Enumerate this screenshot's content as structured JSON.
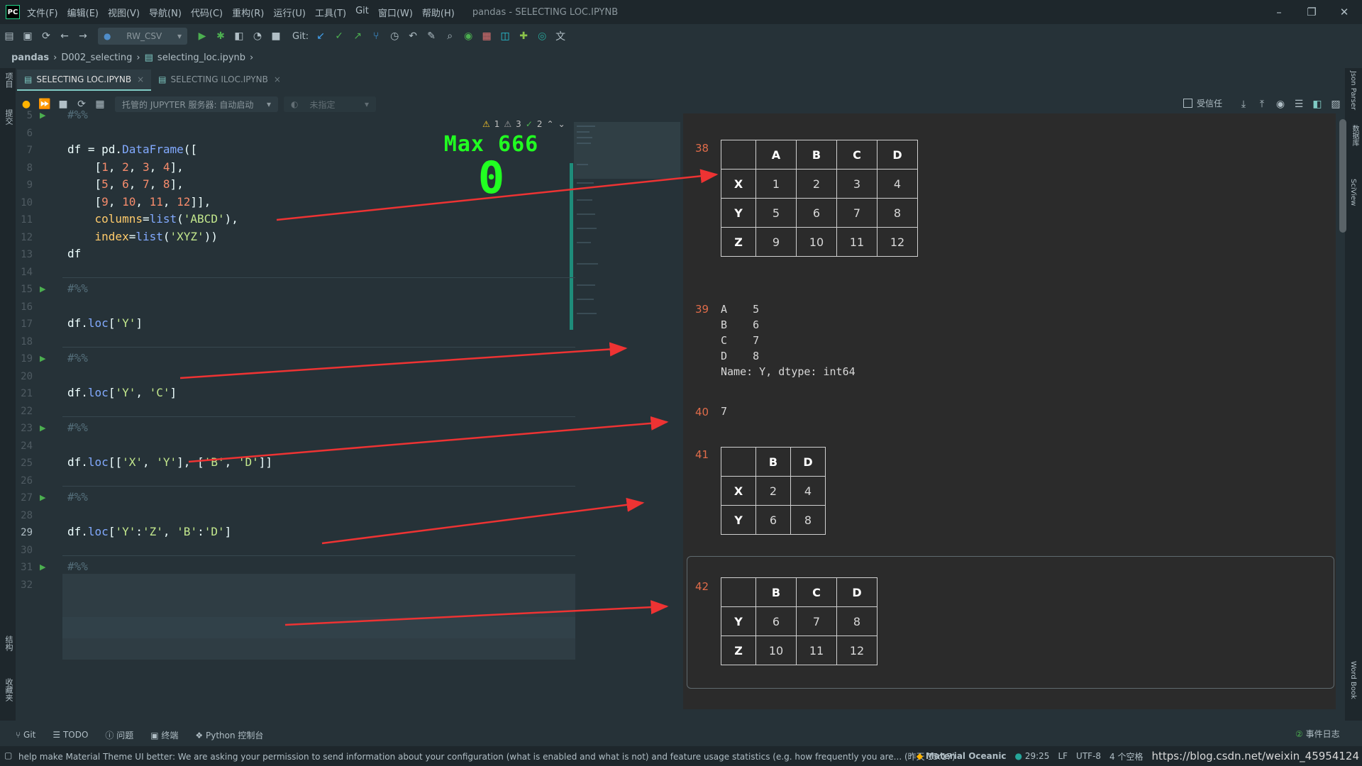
{
  "window": {
    "menus": [
      "文件(F)",
      "编辑(E)",
      "视图(V)",
      "导航(N)",
      "代码(C)",
      "重构(R)",
      "运行(U)",
      "工具(T)",
      "Git",
      "窗口(W)",
      "帮助(H)"
    ],
    "title": "pandas - SELECTING LOC.IPYNB"
  },
  "toolbar": {
    "run_config": "RW_CSV",
    "git_label": "Git:"
  },
  "breadcrumb": [
    "pandas",
    "D002_selecting",
    "selecting_loc.ipynb"
  ],
  "tabs": [
    {
      "label": "SELECTING LOC.IPYNB",
      "active": true
    },
    {
      "label": "SELECTING ILOC.IPYNB",
      "active": false
    }
  ],
  "notebook_bar": {
    "server": "托管的 JUPYTER 服务器: 自动启动",
    "kernel": "未指定",
    "trusted": "受信任"
  },
  "inspections": {
    "warnings": "1",
    "weak_warnings": "3",
    "ok": "2"
  },
  "game": {
    "title": "Max 666",
    "score": "0"
  },
  "code_lines": [
    {
      "n": "5",
      "text": "#%%"
    },
    {
      "n": "6",
      "text": ""
    },
    {
      "n": "7",
      "text": "df = pd.DataFrame(["
    },
    {
      "n": "8",
      "text": "    [1, 2, 3, 4],"
    },
    {
      "n": "9",
      "text": "    [5, 6, 7, 8],"
    },
    {
      "n": "10",
      "text": "    [9, 10, 11, 12]],"
    },
    {
      "n": "11",
      "text": "    columns=list('ABCD'),"
    },
    {
      "n": "12",
      "text": "    index=list('XYZ'))"
    },
    {
      "n": "13",
      "text": "df"
    },
    {
      "n": "14",
      "text": ""
    },
    {
      "n": "15",
      "text": "#%%"
    },
    {
      "n": "16",
      "text": ""
    },
    {
      "n": "17",
      "text": "df.loc['Y']"
    },
    {
      "n": "18",
      "text": ""
    },
    {
      "n": "19",
      "text": "#%%"
    },
    {
      "n": "20",
      "text": ""
    },
    {
      "n": "21",
      "text": "df.loc['Y', 'C']"
    },
    {
      "n": "22",
      "text": ""
    },
    {
      "n": "23",
      "text": "#%%"
    },
    {
      "n": "24",
      "text": ""
    },
    {
      "n": "25",
      "text": "df.loc[['X', 'Y'], ['B', 'D']]"
    },
    {
      "n": "26",
      "text": ""
    },
    {
      "n": "27",
      "text": "#%%"
    },
    {
      "n": "28",
      "text": ""
    },
    {
      "n": "29",
      "text": "df.loc['Y':'Z', 'B':'D']"
    },
    {
      "n": "30",
      "text": ""
    },
    {
      "n": "31",
      "text": "#%%"
    },
    {
      "n": "32",
      "text": ""
    }
  ],
  "outputs": {
    "out38": {
      "num": "38",
      "columns": [
        "A",
        "B",
        "C",
        "D"
      ],
      "rows": [
        [
          "X",
          "1",
          "2",
          "3",
          "4"
        ],
        [
          "Y",
          "5",
          "6",
          "7",
          "8"
        ],
        [
          "Z",
          "9",
          "10",
          "11",
          "12"
        ]
      ]
    },
    "out39": {
      "num": "39",
      "lines": [
        "A    5",
        "B    6",
        "C    7",
        "D    8",
        "Name: Y, dtype: int64"
      ]
    },
    "out40": {
      "num": "40",
      "value": "7"
    },
    "out41": {
      "num": "41",
      "columns": [
        "B",
        "D"
      ],
      "rows": [
        [
          "X",
          "2",
          "4"
        ],
        [
          "Y",
          "6",
          "8"
        ]
      ]
    },
    "out42": {
      "num": "42",
      "columns": [
        "B",
        "C",
        "D"
      ],
      "rows": [
        [
          "Y",
          "6",
          "7",
          "8"
        ],
        [
          "Z",
          "10",
          "11",
          "12"
        ]
      ]
    }
  },
  "bottom_tools": [
    "Git",
    "TODO",
    "问题",
    "终端",
    "Python 控制台"
  ],
  "event_log": "事件日志",
  "side_tools": {
    "left": [
      "项目",
      "提交",
      "结构",
      "收藏夹"
    ],
    "right": [
      "Json Parser",
      "数据库",
      "SciView",
      "Word Book"
    ]
  },
  "status": {
    "message": "help make Material Theme UI better: We are asking your permission to send information about your configuration (what is enabled and what is not) and feature usage statistics (e.g. how frequently you are... (昨天 15:17)",
    "theme": "Material Oceanic",
    "position": "29:25",
    "line_sep": "LF",
    "encoding": "UTF-8",
    "indent": "4 个空格",
    "watermark": "https://blog.csdn.net/weixin_45954124"
  }
}
